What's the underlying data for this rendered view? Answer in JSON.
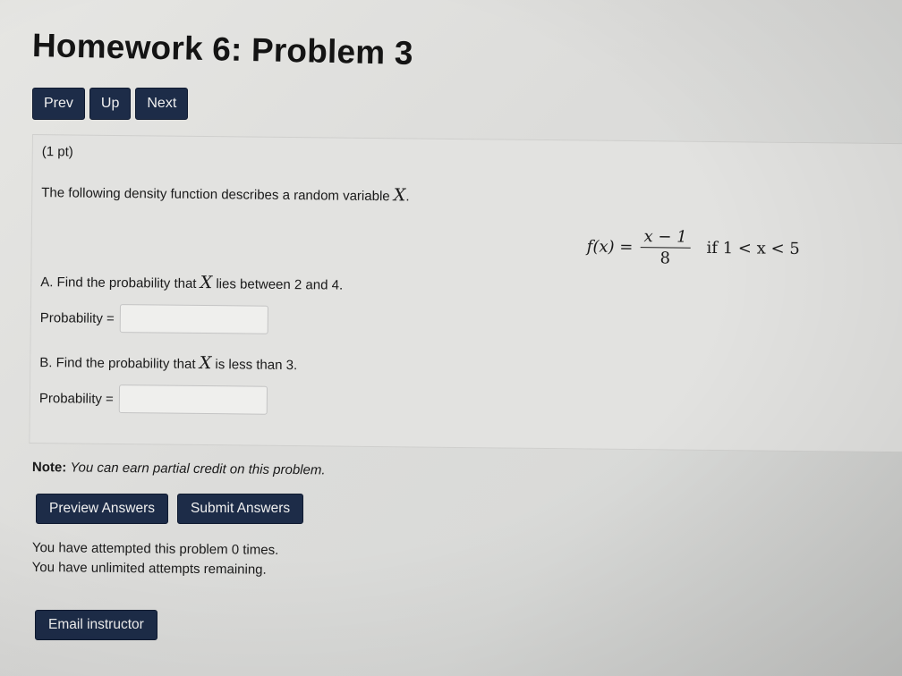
{
  "page": {
    "title": "Homework 6: Problem 3"
  },
  "nav": {
    "prev_label": "Prev",
    "up_label": "Up",
    "next_label": "Next"
  },
  "problem": {
    "points": "(1 pt)",
    "statement_prefix": "The following density function describes a random variable",
    "statement_var": "X",
    "statement_suffix": ".",
    "formula": {
      "lhs": "f(x) =",
      "numerator": "x − 1",
      "denominator": "8",
      "condition": "if 1 < x < 5"
    },
    "part_a": {
      "question_prefix": "A. Find the probability that",
      "question_var": "X",
      "question_suffix": "lies between 2 and 4.",
      "answer_label": "Probability =",
      "answer_value": ""
    },
    "part_b": {
      "question_prefix": "B. Find the probability that",
      "question_var": "X",
      "question_suffix": "is less than 3.",
      "answer_label": "Probability =",
      "answer_value": ""
    }
  },
  "note": {
    "label": "Note:",
    "text": "You can earn partial credit on this problem."
  },
  "actions": {
    "preview_label": "Preview Answers",
    "submit_label": "Submit Answers"
  },
  "attempts": {
    "line1": "You have attempted this problem 0 times.",
    "line2": "You have unlimited attempts remaining."
  },
  "email": {
    "label": "Email instructor"
  },
  "colors": {
    "button_bg": "#1d2c48",
    "page_bg": "#e4e4e2"
  }
}
